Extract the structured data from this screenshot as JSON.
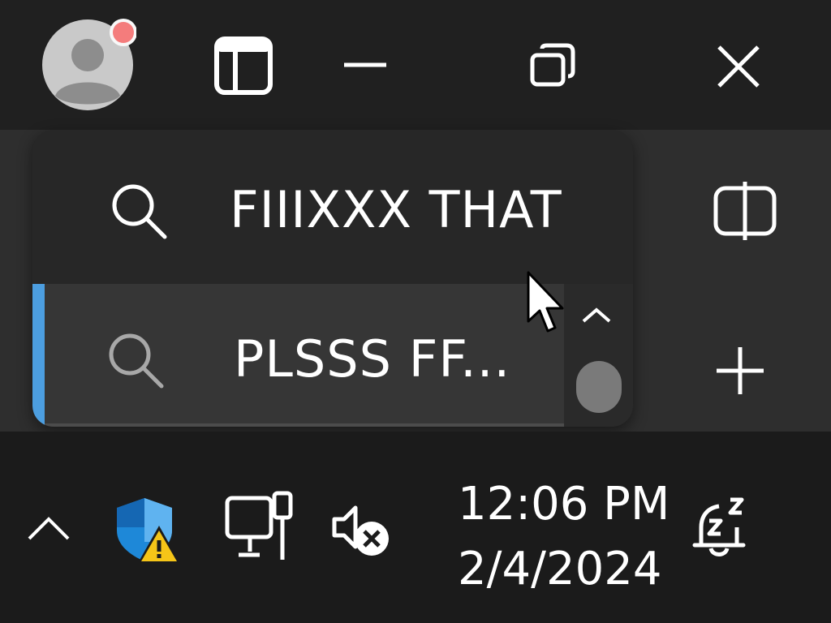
{
  "window": {
    "avatar": "user-avatar",
    "controls": [
      "sidebar-panel-icon",
      "minimize-icon",
      "restore-icon",
      "close-icon"
    ]
  },
  "tabs": [
    {
      "title": "FIIIXXX THAT",
      "icon": "search-icon",
      "active": false
    },
    {
      "title": "PLSSS FF...",
      "icon": "search-icon",
      "active": true
    }
  ],
  "side_buttons": [
    "split-screen-icon",
    "new-tab-icon"
  ],
  "taskbar": {
    "time": "12:06 PM",
    "date": "2/4/2024",
    "tray_icons": [
      "show-hidden-icons-chevron",
      "windows-security-warning-icon",
      "network-ethernet-icon",
      "volume-muted-icon",
      "notifications-snooze-icon"
    ]
  },
  "colors": {
    "accent": "#4c9ee0",
    "notification_dot": "#f47c7c",
    "warning": "#f5c518",
    "shield": "#1e88d8"
  }
}
